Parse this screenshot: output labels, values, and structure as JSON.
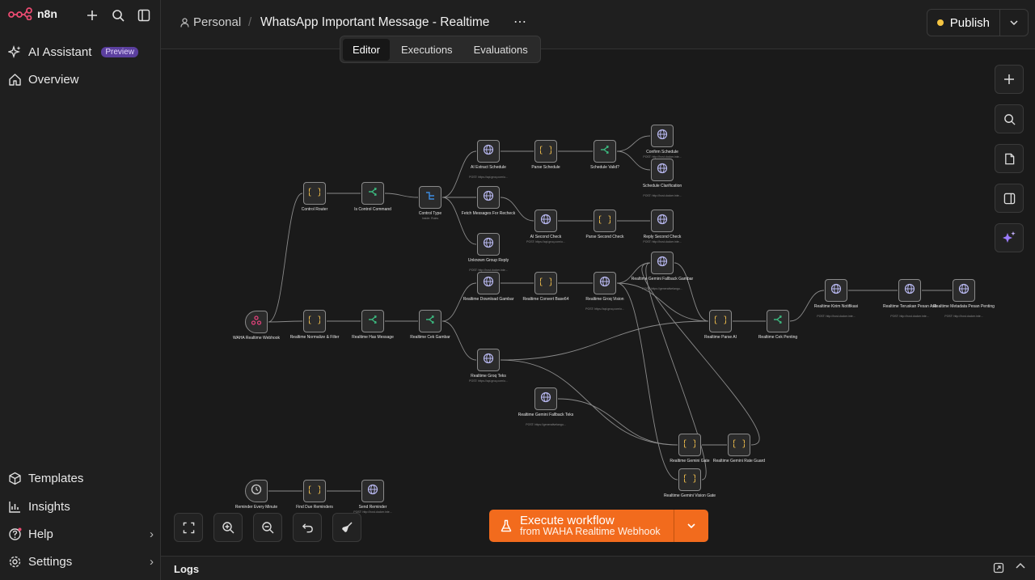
{
  "app": {
    "name": "n8n"
  },
  "sidebar": {
    "top_items": [
      {
        "label": "AI Assistant",
        "badge": "Preview",
        "icon": "sparkles-icon"
      },
      {
        "label": "Overview",
        "icon": "home-icon"
      }
    ],
    "bottom_items": [
      {
        "label": "Templates",
        "icon": "box-icon"
      },
      {
        "label": "Insights",
        "icon": "chart-icon"
      },
      {
        "label": "Help",
        "icon": "help-icon"
      },
      {
        "label": "Settings",
        "icon": "gear-icon"
      }
    ]
  },
  "header": {
    "project": "Personal",
    "workflow_name": "WhatsApp Important Message - Realtime",
    "tabs": [
      "Editor",
      "Executions",
      "Evaluations"
    ],
    "active_tab": "Editor",
    "publish_label": "Publish"
  },
  "execute": {
    "title": "Execute workflow",
    "subtitle": "from WAHA Realtime Webhook"
  },
  "logs": {
    "label": "Logs"
  },
  "nodes": [
    {
      "id": "waha",
      "label": "WAHA Realtime Webhook",
      "icon": "webhook-icon",
      "color": "#e0417a"
    },
    {
      "id": "ctrl-router",
      "label": "Control Router",
      "icon": "code-icon",
      "color": "#e8b84a"
    },
    {
      "id": "is-ctrl",
      "label": "Is Control Command",
      "icon": "if-icon",
      "color": "#3bb77e"
    },
    {
      "id": "ctrl-type",
      "label": "Control Type",
      "sub": "Inside: Rules",
      "icon": "switch-icon",
      "color": "#3d8be0"
    },
    {
      "id": "ai-extract",
      "label": "AI Extract Schedule",
      "sub": "POST: https://api.groq.com/o...",
      "icon": "http-icon",
      "color": "#b8b8f0"
    },
    {
      "id": "parse-sched",
      "label": "Parse Schedule",
      "icon": "code-icon",
      "color": "#e8b84a"
    },
    {
      "id": "sched-valid",
      "label": "Schedule Valid?",
      "icon": "if-icon",
      "color": "#3bb77e"
    },
    {
      "id": "confirm",
      "label": "Confirm Schedule",
      "sub": "POST: http://host.docker.inte...",
      "icon": "http-icon",
      "color": "#b8b8f0"
    },
    {
      "id": "clarify",
      "label": "Schedule Clarification",
      "sub": "POST: http://host.docker.inte...",
      "icon": "http-icon",
      "color": "#b8b8f0"
    },
    {
      "id": "fetch",
      "label": "Fetch Messages For Recheck",
      "icon": "http-icon",
      "color": "#b8b8f0"
    },
    {
      "id": "ai-second",
      "label": "AI Second Check",
      "sub": "POST: https://api.groq.com/o...",
      "icon": "http-icon",
      "color": "#b8b8f0"
    },
    {
      "id": "parse-second",
      "label": "Parse Second Check",
      "icon": "code-icon",
      "color": "#e8b84a"
    },
    {
      "id": "reply-second",
      "label": "Reply Second Check",
      "sub": "POST: http://host.docker.inte...",
      "icon": "http-icon",
      "color": "#b8b8f0"
    },
    {
      "id": "unknown",
      "label": "Unknown Group Reply",
      "sub": "POST: http://host.docker.inte...",
      "icon": "http-icon",
      "color": "#b8b8f0"
    },
    {
      "id": "normalize",
      "label": "Realtime Normalize & Filter",
      "icon": "code-icon",
      "color": "#e8b84a"
    },
    {
      "id": "has-msg",
      "label": "Realtime Has Message",
      "icon": "if-icon",
      "color": "#3bb77e"
    },
    {
      "id": "cek-gambar",
      "label": "Realtime Cek Gambar",
      "icon": "if-icon",
      "color": "#3bb77e"
    },
    {
      "id": "download",
      "label": "Realtime Download Gambar",
      "icon": "http-icon",
      "color": "#b8b8f0"
    },
    {
      "id": "convert",
      "label": "Realtime Convert Base64",
      "icon": "code-icon",
      "color": "#e8b84a"
    },
    {
      "id": "groq-vision",
      "label": "Realtime Groq Vision",
      "sub": "POST: https://api.groq.com/o...",
      "icon": "http-icon",
      "color": "#b8b8f0"
    },
    {
      "id": "gemini-fb-gambar",
      "label": "Realtime Gemini Fallback Gambar",
      "sub": "POST: https://generativelangu...",
      "icon": "http-icon",
      "color": "#b8b8f0"
    },
    {
      "id": "groq-teks",
      "label": "Realtime Groq Teks",
      "sub": "POST: https://api.groq.com/o...",
      "icon": "http-icon",
      "color": "#b8b8f0"
    },
    {
      "id": "gemini-fb-teks",
      "label": "Realtime Gemini Fallback Teks",
      "sub": "POST: https://generativelangu...",
      "icon": "http-icon",
      "color": "#b8b8f0"
    },
    {
      "id": "parse-ai",
      "label": "Realtime Parse AI",
      "icon": "code-icon",
      "color": "#e8b84a"
    },
    {
      "id": "cek-penting",
      "label": "Realtime Cek Penting",
      "icon": "if-icon",
      "color": "#3bb77e"
    },
    {
      "id": "kirim",
      "label": "Realtime Kirim Notifikasi",
      "sub": "POST: http://host.docker.inte...",
      "icon": "http-icon",
      "color": "#b8b8f0"
    },
    {
      "id": "teruskan",
      "label": "Realtime Teruskan Pesan Asli",
      "sub": "POST: http://host.docker.inte...",
      "icon": "http-icon",
      "color": "#b8b8f0"
    },
    {
      "id": "metadata",
      "label": "Realtime Metadata Pesan Penting",
      "sub": "POST: http://host.docker.inte...",
      "icon": "http-icon",
      "color": "#b8b8f0"
    },
    {
      "id": "gemini-gate",
      "label": "Realtime Gemini Gate",
      "icon": "code-icon",
      "color": "#e8b84a"
    },
    {
      "id": "rate-guard",
      "label": "Realtime Gemini Rate Guard",
      "icon": "code-icon",
      "color": "#e8b84a"
    },
    {
      "id": "vision-gate",
      "label": "Realtime Gemini Vision Gate",
      "icon": "code-icon",
      "color": "#e8b84a"
    },
    {
      "id": "reminder",
      "label": "Reminder Every Minute",
      "icon": "clock-icon",
      "color": "#cccccc"
    },
    {
      "id": "find-due",
      "label": "Find Due Reminders",
      "icon": "code-icon",
      "color": "#e8b84a"
    },
    {
      "id": "send-rem",
      "label": "Send Reminder",
      "sub": "POST: http://host.docker.inte...",
      "icon": "http-icon",
      "color": "#b8b8f0"
    }
  ]
}
